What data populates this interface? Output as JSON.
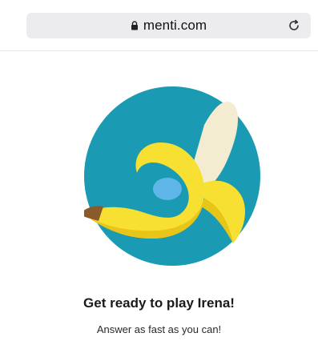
{
  "browser": {
    "url": "menti.com",
    "icons": {
      "lock": "lock-icon",
      "reload": "reload-icon"
    }
  },
  "main": {
    "heading": "Get ready to play Irena!",
    "subheading": "Answer as fast as you can!",
    "illustration": "banana-illustration"
  },
  "colors": {
    "circle": "#1a9bb3",
    "banana_yellow": "#f7e032",
    "banana_dark_yellow": "#e8c516",
    "peel_cream": "#f3ecd0",
    "stem_brown": "#8a5a2b",
    "blue_accent": "#5fb6e8"
  }
}
